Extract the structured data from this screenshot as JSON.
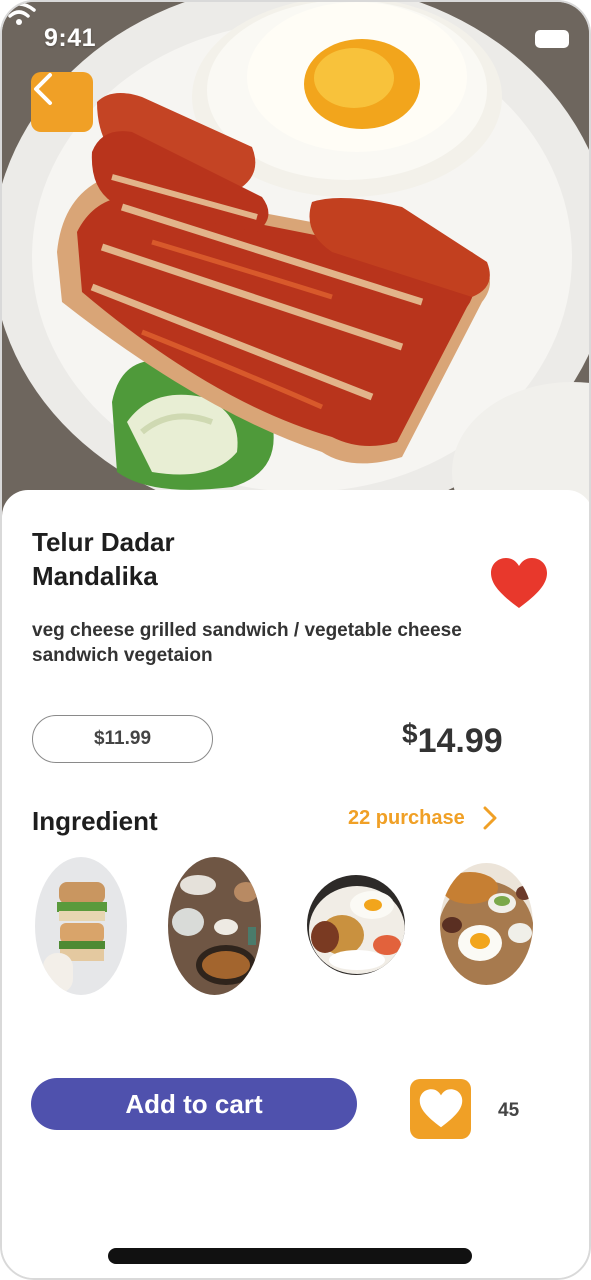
{
  "status_bar": {
    "time": "9:41"
  },
  "product": {
    "title_line1": "Telur Dadar",
    "title_line2": "Mandalika",
    "description": "veg cheese grilled sandwich / vegetable cheese sandwich vegetaion",
    "old_price": "$11.99",
    "price_currency": "$",
    "price_amount": "14.99",
    "favorited": true
  },
  "ingredients_section": {
    "title": "Ingredient",
    "purchase_label": "22 purchase",
    "items": [
      {
        "icon": "sandwich-photo"
      },
      {
        "icon": "table-dishes-photo"
      },
      {
        "icon": "egg-rice-plate-photo"
      },
      {
        "icon": "breakfast-platter-photo"
      }
    ]
  },
  "actions": {
    "add_to_cart_label": "Add to cart",
    "like_count": "45"
  },
  "colors": {
    "accent_orange": "#f0a026",
    "primary_purple": "#4f51ad",
    "heart_red": "#e8382c"
  }
}
